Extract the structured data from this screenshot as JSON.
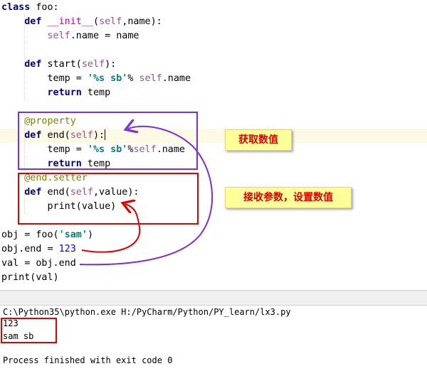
{
  "editor": {
    "lines": [
      "class foo:",
      "    def __init__(self,name):",
      "        self.name = name",
      "",
      "    def start(self):",
      "        temp = '%s sb'% self.name",
      "        return temp",
      "",
      "    @property",
      "    def end(self):",
      "        temp = '%s sb'%self.name",
      "        return temp",
      "    @end.setter",
      "    def end(self,value):",
      "        print(value)",
      "",
      "obj = foo('sam')",
      "obj.end = 123",
      "val = obj.end",
      "print(val)"
    ]
  },
  "annotations": {
    "getter_note": "获取数值",
    "setter_note": "接收参数，设置数值"
  },
  "console": {
    "command": "C:\\Python35\\python.exe H:/PyCharm/Python/PY_learn/lx3.py",
    "output": [
      "123",
      "sam sb"
    ],
    "exit_message": "Process finished with exit code 0"
  },
  "colors": {
    "purple_box": "#7b2fd6",
    "red_box": "#e00000",
    "note_background": "#ffff99",
    "current_line_highlight": "#fcf9e4"
  }
}
